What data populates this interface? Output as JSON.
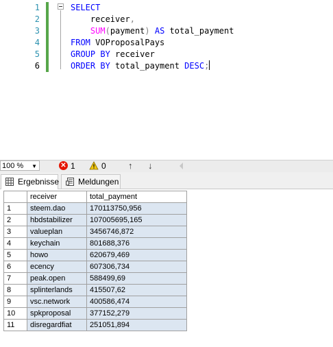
{
  "editor": {
    "lines": [
      {
        "num": "1",
        "tokens": [
          {
            "t": "SELECT",
            "c": "kw"
          }
        ]
      },
      {
        "num": "2",
        "tokens": [
          {
            "t": "    receiver",
            "c": ""
          },
          {
            "t": ",",
            "c": "gray"
          }
        ]
      },
      {
        "num": "3",
        "tokens": [
          {
            "t": "    ",
            "c": ""
          },
          {
            "t": "SUM",
            "c": "fn"
          },
          {
            "t": "(",
            "c": "gray"
          },
          {
            "t": "payment",
            "c": ""
          },
          {
            "t": ")",
            "c": "gray"
          },
          {
            "t": " ",
            "c": ""
          },
          {
            "t": "AS",
            "c": "kw"
          },
          {
            "t": " total_payment",
            "c": ""
          }
        ]
      },
      {
        "num": "4",
        "tokens": [
          {
            "t": "FROM",
            "c": "kw"
          },
          {
            "t": " VOProposalPays",
            "c": ""
          }
        ]
      },
      {
        "num": "5",
        "tokens": [
          {
            "t": "GROUP BY",
            "c": "kw"
          },
          {
            "t": " receiver",
            "c": ""
          }
        ]
      },
      {
        "num": "6",
        "tokens": [
          {
            "t": "ORDER BY",
            "c": "kw"
          },
          {
            "t": " total_payment ",
            "c": ""
          },
          {
            "t": "DESC",
            "c": "kw"
          },
          {
            "t": ";",
            "c": "gray"
          }
        ]
      }
    ],
    "current_line": "6"
  },
  "status": {
    "zoom": "100 %",
    "error_count": "1",
    "warning_count": "0"
  },
  "tabs": {
    "results": "Ergebnisse",
    "messages": "Meldungen"
  },
  "grid": {
    "columns": [
      "receiver",
      "total_payment"
    ],
    "rows": [
      [
        "1",
        "steem.dao",
        "170113750,956"
      ],
      [
        "2",
        "hbdstabilizer",
        "107005695,165"
      ],
      [
        "3",
        "valueplan",
        "3456746,872"
      ],
      [
        "4",
        "keychain",
        "801688,376"
      ],
      [
        "5",
        "howo",
        "620679,469"
      ],
      [
        "6",
        "ecency",
        "607306,734"
      ],
      [
        "7",
        "peak.open",
        "588499,69"
      ],
      [
        "8",
        "splinterlands",
        "415507,62"
      ],
      [
        "9",
        "vsc.network",
        "400586,474"
      ],
      [
        "10",
        "spkproposal",
        "377152,279"
      ],
      [
        "11",
        "disregardfiat",
        "251051,894"
      ]
    ]
  }
}
